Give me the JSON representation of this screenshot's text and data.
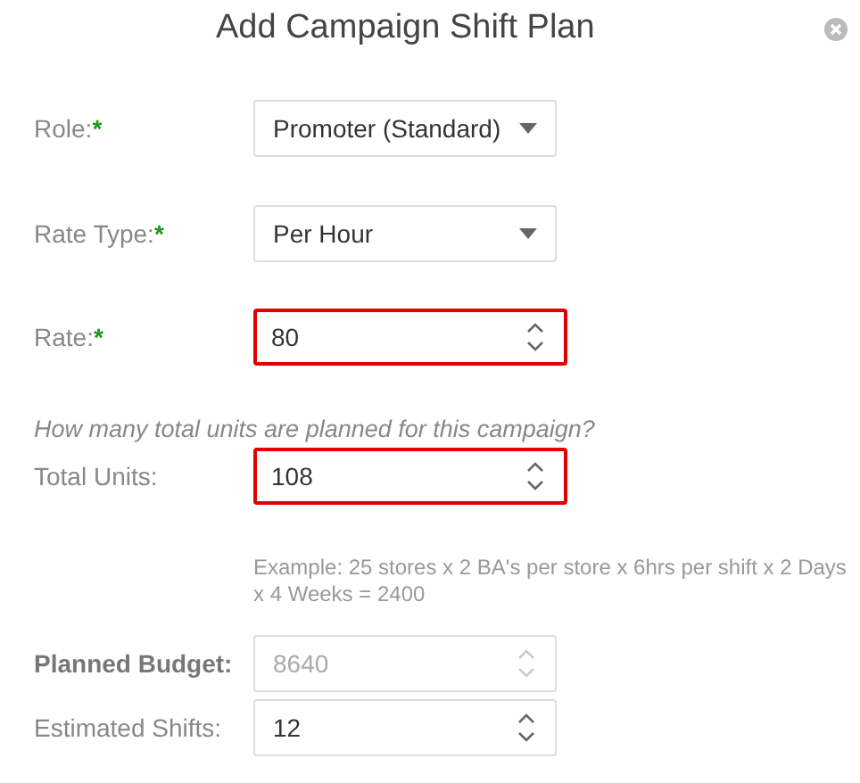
{
  "dialog": {
    "title": "Add Campaign Shift Plan"
  },
  "rows": [
    {
      "kind": "select",
      "label": "Role:",
      "mark": "*",
      "value": "Promoter (Standard)",
      "invalid": false,
      "disabled": false,
      "bold": false
    },
    {
      "kind": "select",
      "label": "Rate Type:",
      "mark": "*",
      "value": "Per Hour",
      "invalid": false,
      "disabled": false,
      "bold": false
    },
    {
      "kind": "number",
      "label": "Rate:",
      "mark": "*",
      "value": "80",
      "invalid": true,
      "disabled": false,
      "bold": false
    },
    {
      "kind": "question",
      "text": "How many total units are planned for this campaign?"
    },
    {
      "kind": "number",
      "label": "Total Units:",
      "value": "108",
      "invalid": true,
      "disabled": false,
      "bold": false
    },
    {
      "kind": "note",
      "text": "Example: 25 stores x 2 BA's per store x 6hrs per shift x 2 Days x 4 Weeks = 2400"
    },
    {
      "kind": "number",
      "label": "Planned Budget:",
      "value": "8640",
      "invalid": false,
      "disabled": true,
      "bold": true
    },
    {
      "kind": "number",
      "label": "Estimated Shifts:",
      "value": "12",
      "invalid": false,
      "disabled": false,
      "bold": false
    }
  ]
}
